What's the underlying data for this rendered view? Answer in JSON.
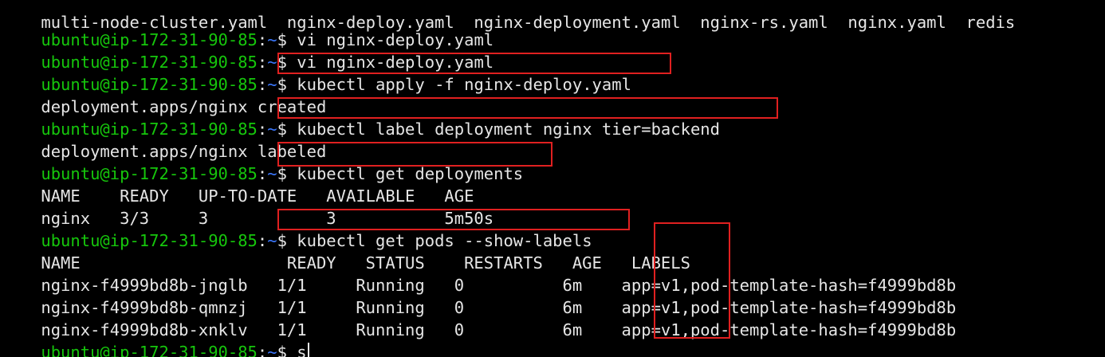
{
  "prompt": {
    "user_host": "ubuntu@ip-172-31-90-85",
    "colon": ":",
    "path": "~",
    "dollar": "$ "
  },
  "lines": [
    {
      "type": "prompt",
      "cmd": "vi nginx-deploy.yaml",
      "partial_top": true,
      "top_text": "multi-node-cluster.yaml  nginx-deploy.yaml  nginx-deployment.yaml  nginx-rs.yaml  nginx.yaml  redis"
    },
    {
      "type": "prompt",
      "cmd": "vi nginx-deploy.yaml"
    },
    {
      "type": "prompt",
      "cmd": "kubectl apply -f nginx-deploy.yaml",
      "highlight": true
    },
    {
      "type": "output",
      "text": "deployment.apps/nginx created"
    },
    {
      "type": "prompt",
      "cmd": "kubectl label deployment nginx tier=backend",
      "highlight": true
    },
    {
      "type": "output",
      "text": "deployment.apps/nginx labeled"
    },
    {
      "type": "prompt",
      "cmd": "kubectl get deployments",
      "highlight": true
    },
    {
      "type": "output",
      "text": "NAME    READY   UP-TO-DATE   AVAILABLE   AGE"
    },
    {
      "type": "output",
      "text": "nginx   3/3     3            3           5m50s"
    },
    {
      "type": "prompt",
      "cmd": "kubectl get pods --show-labels",
      "highlight": true
    },
    {
      "type": "output",
      "text": "NAME                     READY   STATUS    RESTARTS   AGE   LABELS"
    },
    {
      "type": "output",
      "text": "nginx-f4999bd8b-jnglb   1/1     Running   0          6m    app=v1,pod-template-hash=f4999bd8b"
    },
    {
      "type": "output",
      "text": "nginx-f4999bd8b-qmnzj   1/1     Running   0          6m    app=v1,pod-template-hash=f4999bd8b"
    },
    {
      "type": "output",
      "text": "nginx-f4999bd8b-xnklv   1/1     Running   0          6m    app=v1,pod-template-hash=f4999bd8b"
    },
    {
      "type": "prompt",
      "cmd": "s",
      "cursor": true
    }
  ],
  "colors": {
    "background": "#000000",
    "prompt_user": "#16c60c",
    "prompt_path": "#3b78ff",
    "text": "#e6e6e6",
    "highlight_box": "#e02020"
  }
}
